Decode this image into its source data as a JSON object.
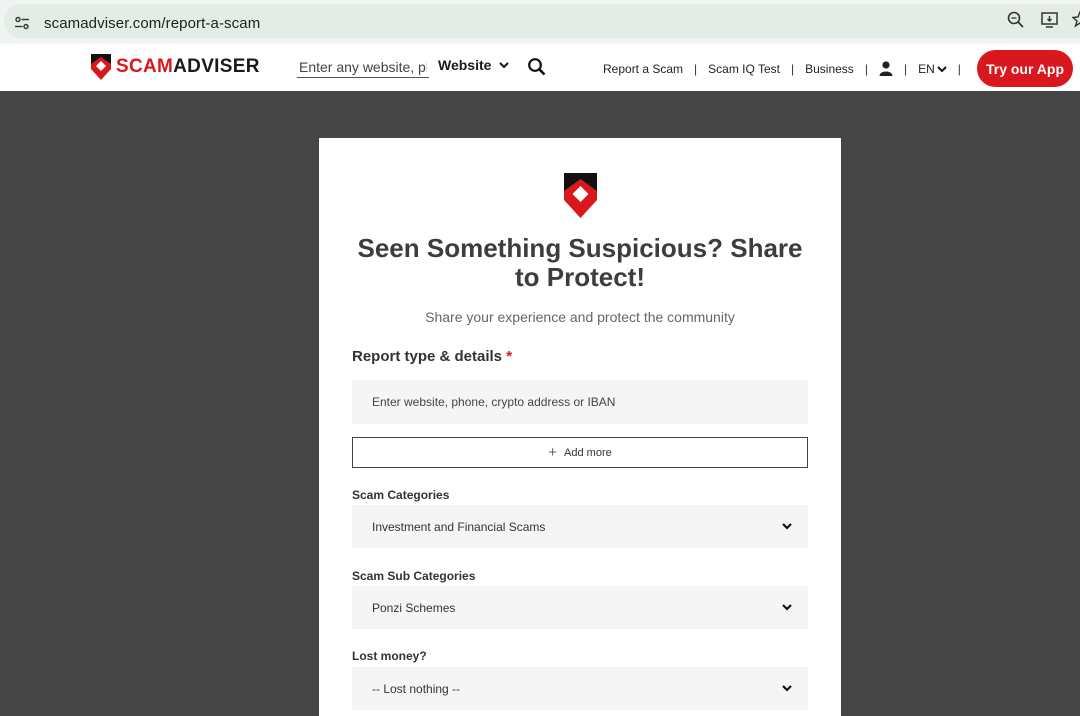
{
  "browser": {
    "url": "scamadviser.com/report-a-scam"
  },
  "header": {
    "logo_scam": "SCAM",
    "logo_adviser": "ADVISER",
    "search_placeholder": "Enter any website, ph",
    "type_select": "Website",
    "nav": {
      "report": "Report a Scam",
      "iq_test": "Scam IQ Test",
      "business": "Business",
      "lang": "EN",
      "separator": "|"
    },
    "app_button": "Try our App"
  },
  "card": {
    "title": "Seen Something Suspicious? Share to Protect!",
    "subtitle": "Share your experience and protect the community",
    "section_title": "Report type & details",
    "required_mark": "*",
    "input_placeholder": "Enter website, phone, crypto address or IBAN",
    "add_more": "Add more",
    "add_more_icon": "+",
    "scam_categories_label": "Scam Categories",
    "scam_categories_value": "Investment and Financial Scams",
    "scam_sub_label": "Scam Sub Categories",
    "scam_sub_value": "Ponzi Schemes",
    "lost_money_label": "Lost money?",
    "lost_money_value": "-- Lost nothing --"
  },
  "colors": {
    "brand_red": "#d9181e",
    "page_bg": "#464646",
    "field_bg": "#f5f5f5"
  }
}
